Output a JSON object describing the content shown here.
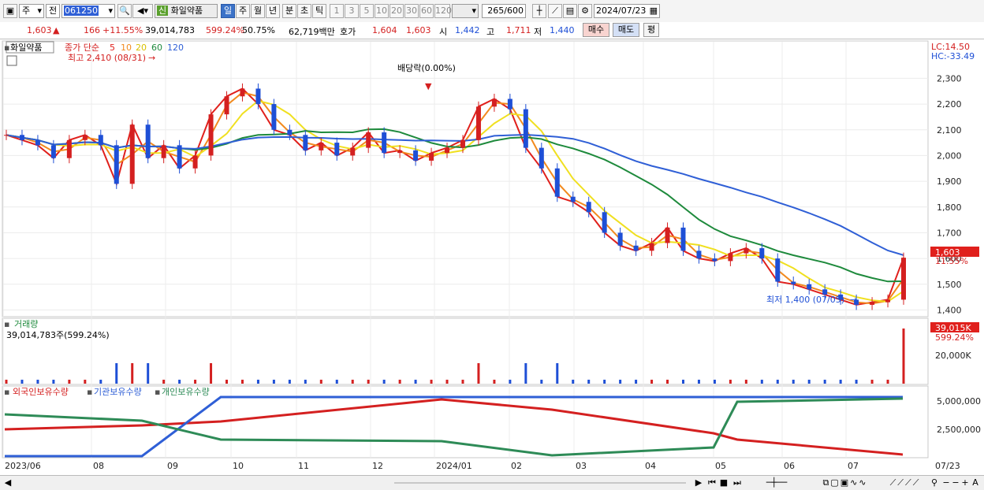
{
  "toolbar": {
    "tab_week": "주",
    "tab_prev": "전",
    "code": "061250",
    "stock_badge": "신",
    "stock_name": "화일약품",
    "periods": [
      "일",
      "주",
      "월",
      "년",
      "분",
      "초",
      "틱"
    ],
    "intervals": [
      "1",
      "3",
      "5",
      "10",
      "20",
      "30",
      "60",
      "120"
    ],
    "count": "265",
    "count_max": "/600",
    "date": "2024/07/23"
  },
  "quote": {
    "price": "1,603",
    "change_arrow": "▲",
    "change": "166",
    "change_pct": "+11.55%",
    "volume": "39,014,783",
    "volume_ratio": "599.24%",
    "turnover": "50.75%",
    "amount": "62,719백만",
    "ask_label": "호가",
    "ask": "1,604",
    "bid": "1,603",
    "open_label": "시",
    "open": "1,442",
    "high_label": "고",
    "high": "1,711",
    "low_label": "저",
    "low": "1,440",
    "buy": "매수",
    "sell": "매도",
    "flat": "평"
  },
  "price_panel": {
    "name_tag": "화일약품",
    "legend_prefix": "종가 단순",
    "ma_periods": [
      "5",
      "10",
      "20",
      "60",
      "120"
    ],
    "ma_colors": [
      "#e0201c",
      "#f28a1e",
      "#f0e020",
      "#1e8a3c",
      "#2f5fd6"
    ],
    "high_note": "최고 2,410 (08/31)",
    "low_note": "최저 1,400 (07/05)",
    "dividend_note": "배당락(0.00%)",
    "lc": "LC:14.50",
    "hc": "HC:-33.49",
    "current": "1,603",
    "current_pct": "11.55%",
    "y_ticks": [
      "2,300",
      "2,200",
      "2,100",
      "2,000",
      "1,900",
      "1,800",
      "1,700",
      "1,600",
      "1,500",
      "1,400"
    ],
    "y_values": [
      2300,
      2200,
      2100,
      2000,
      1900,
      1800,
      1700,
      1600,
      1500,
      1400
    ]
  },
  "volume_panel": {
    "title": "거래량",
    "summary": "39,014,783주(599.24%)",
    "badge": "39,015K",
    "badge_pct": "599.24%",
    "tick": "20,000K"
  },
  "holdings_panel": {
    "legend": [
      {
        "label": "외국인보유수량",
        "color": "#d42020"
      },
      {
        "label": "기관보유수량",
        "color": "#2f5fd6"
      },
      {
        "label": "개인보유수량",
        "color": "#2e8b57"
      }
    ],
    "ticks": [
      "5,000,000",
      "2,500,000"
    ]
  },
  "x_axis": {
    "labels": [
      "2023/06",
      "08",
      "09",
      "10",
      "11",
      "12",
      "2024/01",
      "02",
      "03",
      "04",
      "05",
      "06",
      "07",
      "07/23"
    ]
  },
  "chart_data": {
    "type": "candlestick",
    "ylim": [
      1380,
      2390
    ],
    "y_ticks": [
      2300,
      2200,
      2100,
      2000,
      1900,
      1800,
      1700,
      1600,
      1500,
      1400
    ],
    "series": [
      {
        "name": "종가",
        "values": [
          2080,
          2060,
          2040,
          1990,
          2060,
          2080,
          2040,
          1890,
          2120,
          1990,
          2040,
          1950,
          2000,
          2160,
          2230,
          2260,
          2200,
          2100,
          2080,
          2020,
          2050,
          2000,
          2030,
          2090,
          2010,
          2020,
          1980,
          2010,
          2030,
          2060,
          2190,
          2220,
          2180,
          2030,
          1950,
          1840,
          1820,
          1780,
          1700,
          1650,
          1630,
          1660,
          1720,
          1630,
          1600,
          1590,
          1620,
          1640,
          1600,
          1510,
          1500,
          1480,
          1460,
          1440,
          1420,
          1430,
          1440,
          1603
        ]
      }
    ],
    "current": 1603,
    "high": {
      "value": 2410,
      "date": "08/31"
    },
    "low": {
      "value": 1400,
      "date": "07/05"
    }
  }
}
